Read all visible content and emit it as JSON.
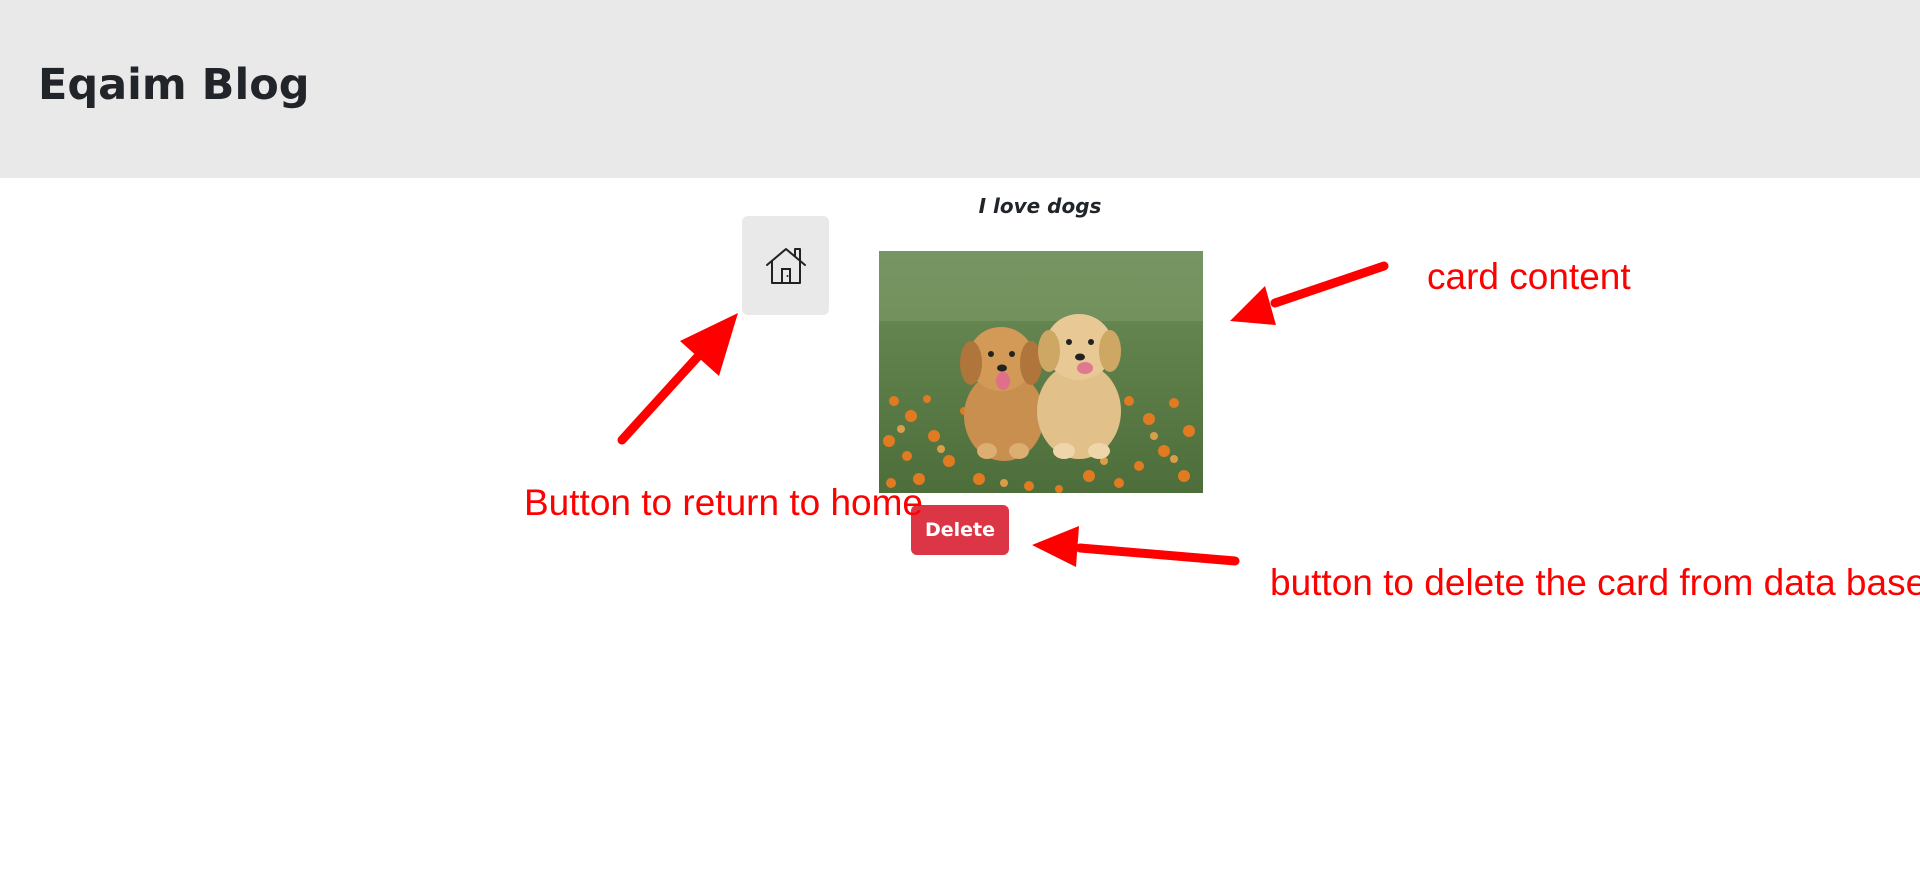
{
  "header": {
    "brand": "Eqaim Blog"
  },
  "card": {
    "title": "I love dogs",
    "image_icon": "dog-photo",
    "delete_label": "Delete"
  },
  "home_button": {
    "icon": "home-icon"
  },
  "annotations": {
    "home": "Button to return to home",
    "card": "card content",
    "delete": "button to delete the card from data base"
  },
  "colors": {
    "header_bg": "#e9e9e9",
    "delete_bg": "#dc3545",
    "annotation": "#ff0000"
  }
}
